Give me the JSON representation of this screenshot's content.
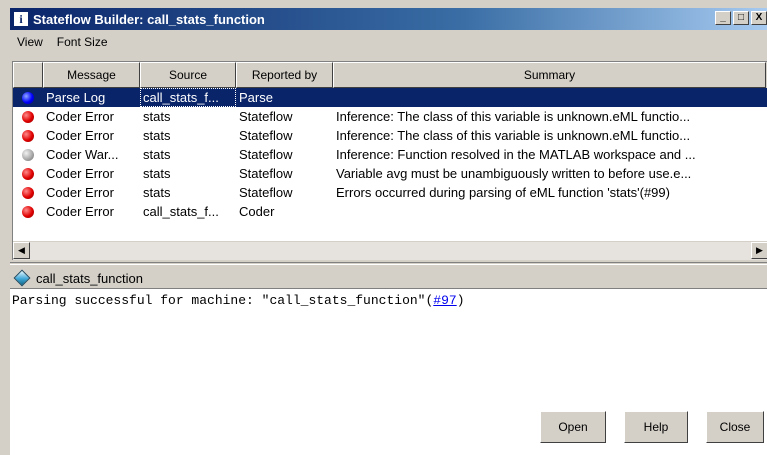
{
  "window": {
    "icon_glyph": "i",
    "title": "Stateflow Builder: call_stats_function",
    "minimize": "_",
    "maximize": "□",
    "close": "X"
  },
  "menu": [
    "View",
    "Font Size"
  ],
  "table": {
    "headers": [
      "",
      "Message",
      "Source",
      "Reported by",
      "Summary"
    ],
    "rows": [
      {
        "icon": "blue-dot-icon",
        "message": "Parse Log",
        "source": "call_stats_f...",
        "reported_by": "Parse",
        "summary": "",
        "selected": true
      },
      {
        "icon": "red-dot-icon",
        "message": "Coder Error",
        "source": "stats",
        "reported_by": "Stateflow",
        "summary": "Inference: The class of this variable is unknown.eML functio..."
      },
      {
        "icon": "red-dot-icon",
        "message": "Coder Error",
        "source": "stats",
        "reported_by": "Stateflow",
        "summary": "Inference: The class of this variable is unknown.eML functio..."
      },
      {
        "icon": "gray-dot-icon",
        "message": "Coder War...",
        "source": "stats",
        "reported_by": "Stateflow",
        "summary": "Inference: Function resolved in the MATLAB workspace and ..."
      },
      {
        "icon": "red-dot-icon",
        "message": "Coder Error",
        "source": "stats",
        "reported_by": "Stateflow",
        "summary": "Variable avg must be unambiguously written to before use.e..."
      },
      {
        "icon": "red-dot-icon",
        "message": "Coder Error",
        "source": "stats",
        "reported_by": "Stateflow",
        "summary": "Errors occurred during parsing of eML function 'stats'(#99)"
      },
      {
        "icon": "red-dot-icon",
        "message": "Coder Error",
        "source": "call_stats_f...",
        "reported_by": "Coder",
        "summary": ""
      }
    ]
  },
  "colors": {
    "selection": "#0a246a",
    "error": "#e00000",
    "info": "#0000ff",
    "warning": "#aaaaaa",
    "link": "#0000ee"
  },
  "scrollbar": {
    "left_arrow": "◀",
    "right_arrow": "▶"
  },
  "machine": {
    "icon": "diamond-icon",
    "label": "call_stats_function"
  },
  "output": {
    "prefix": "Parsing successful for machine: \"call_stats_function\"(",
    "link": "#97",
    "suffix": ")"
  },
  "buttons": {
    "open": "Open",
    "help": "Help",
    "close": "Close"
  }
}
